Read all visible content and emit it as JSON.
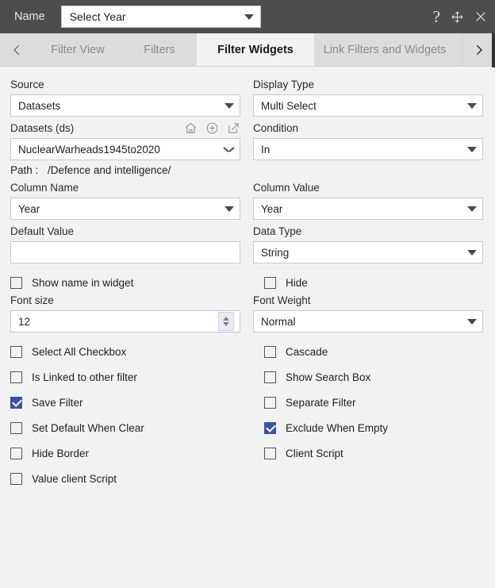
{
  "titlebar": {
    "name_label": "Name",
    "name_value": "Select Year",
    "help_icon": "question-mark-icon",
    "move_icon": "move-arrows-icon",
    "close_icon": "close-icon"
  },
  "tabs": {
    "prev_arrow": "chevron-left-icon",
    "next_arrow": "chevron-right-icon",
    "items": [
      {
        "label": "Filter View",
        "active": false
      },
      {
        "label": "Filters",
        "active": false
      },
      {
        "label": "Filter Widgets",
        "active": true
      },
      {
        "label": "Link Filters and Widgets",
        "active": false
      }
    ]
  },
  "form": {
    "source": {
      "label": "Source",
      "value": "Datasets"
    },
    "display_type": {
      "label": "Display Type",
      "value": "Multi Select"
    },
    "datasets": {
      "label": "Datasets (ds)",
      "value": "NuclearWarheads1945to2020",
      "icons": [
        "home-icon",
        "plus-circle-icon",
        "edit-icon"
      ]
    },
    "condition": {
      "label": "Condition",
      "value": "In"
    },
    "path": {
      "key": "Path :",
      "value": "/Defence and intelligence/"
    },
    "column_name": {
      "label": "Column Name",
      "value": "Year"
    },
    "column_value": {
      "label": "Column Value",
      "value": "Year"
    },
    "default_value": {
      "label": "Default Value",
      "value": "",
      "placeholder": ""
    },
    "data_type": {
      "label": "Data Type",
      "value": "String"
    },
    "font_size": {
      "label": "Font size",
      "value": "12"
    },
    "font_weight": {
      "label": "Font Weight",
      "value": "Normal"
    },
    "checkboxes": [
      {
        "label": "Show name in widget",
        "checked": false
      },
      {
        "label": "Hide",
        "checked": false
      },
      {
        "label": "Select All Checkbox",
        "checked": false
      },
      {
        "label": "Cascade",
        "checked": false
      },
      {
        "label": "Is Linked to other filter",
        "checked": false
      },
      {
        "label": "Show Search Box",
        "checked": false
      },
      {
        "label": "Save Filter",
        "checked": true
      },
      {
        "label": "Separate Filter",
        "checked": false
      },
      {
        "label": "Set Default When Clear",
        "checked": false
      },
      {
        "label": "Exclude When Empty",
        "checked": true
      },
      {
        "label": "Hide Border",
        "checked": false
      },
      {
        "label": "Client Script",
        "checked": false
      },
      {
        "label": "Value client Script",
        "checked": false
      }
    ]
  },
  "colors": {
    "titlebar_bg": "#4d4d4d",
    "tab_inactive_bg": "#dcdcdc",
    "tab_active_bg": "#f2f2f2",
    "body_bg": "#f2f2f2",
    "checkbox_checked": "#3b51a3",
    "field_border": "#c2cbd6"
  }
}
